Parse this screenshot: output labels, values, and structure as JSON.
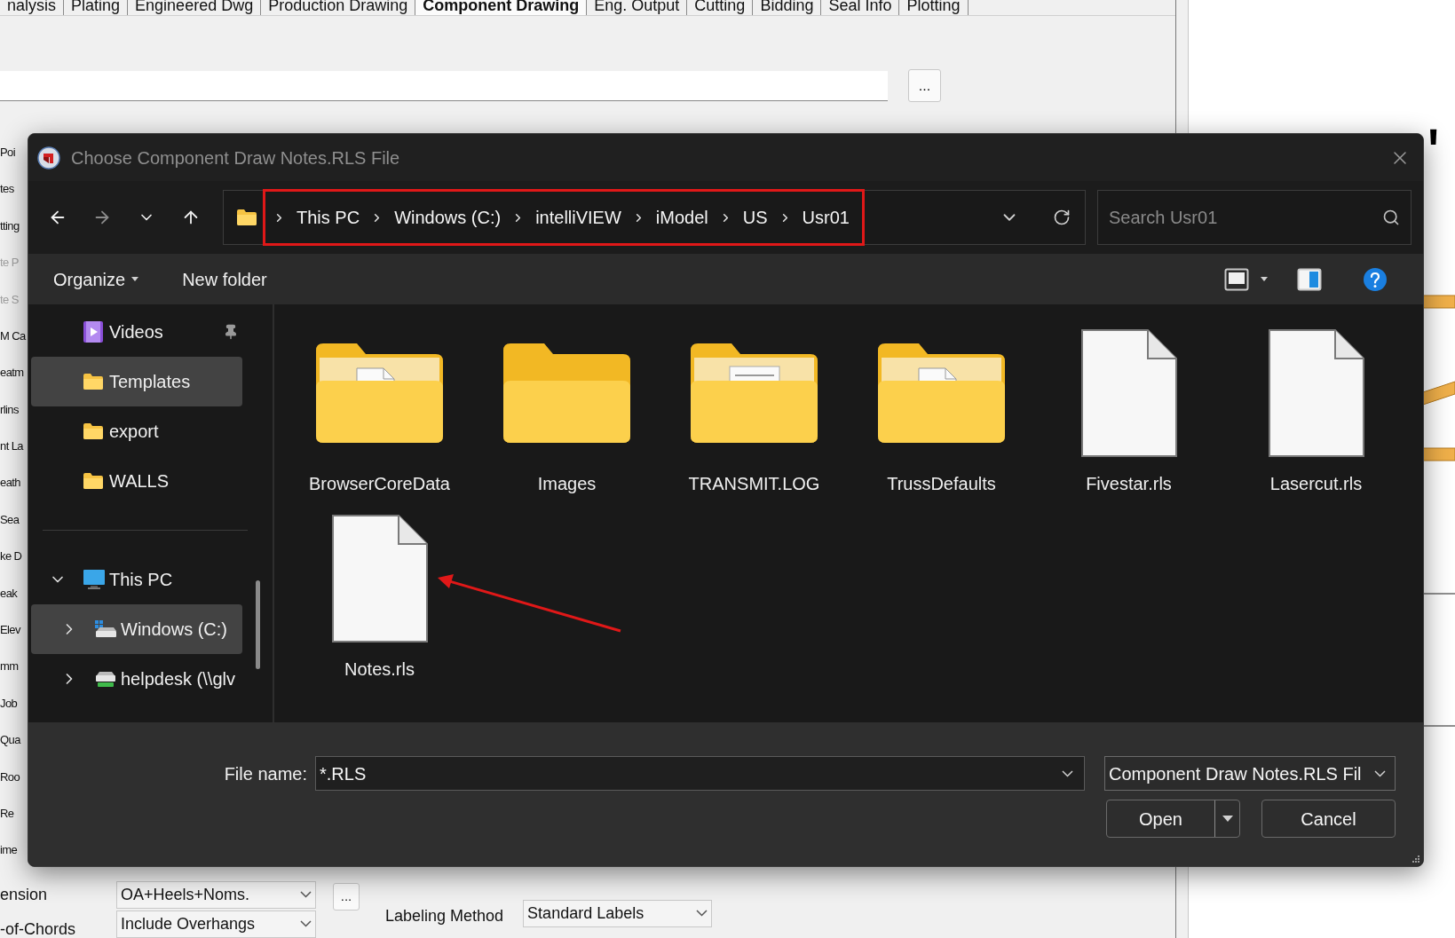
{
  "app": {
    "tabs": [
      {
        "label": "nalysis",
        "selected": false
      },
      {
        "label": "Plating",
        "selected": false
      },
      {
        "label": "Engineered Dwg",
        "selected": false
      },
      {
        "label": "Production Drawing",
        "selected": false
      },
      {
        "label": "Component Drawing",
        "selected": true
      },
      {
        "label": "Eng. Output",
        "selected": false
      },
      {
        "label": "Cutting",
        "selected": false
      },
      {
        "label": "Bidding",
        "selected": false
      },
      {
        "label": "Seal Info",
        "selected": false
      },
      {
        "label": "Plotting",
        "selected": false
      }
    ],
    "browse_button": "...",
    "side_labels": [
      {
        "text": "Poi",
        "disabled": false
      },
      {
        "text": "tes",
        "disabled": false
      },
      {
        "text": "tting",
        "disabled": false
      },
      {
        "text": "te P",
        "disabled": true
      },
      {
        "text": "te S",
        "disabled": true
      },
      {
        "text": "M Ca",
        "disabled": false
      },
      {
        "text": "eatm",
        "disabled": false
      },
      {
        "text": "rlins",
        "disabled": false
      },
      {
        "text": "nt La",
        "disabled": false
      },
      {
        "text": "eath",
        "disabled": false
      },
      {
        "text": "Sea",
        "disabled": false
      },
      {
        "text": "ke D",
        "disabled": false
      },
      {
        "text": "eak",
        "disabled": false
      },
      {
        "text": "Elev",
        "disabled": false
      },
      {
        "text": "mm",
        "disabled": false
      },
      {
        "text": "Job",
        "disabled": false
      },
      {
        "text": "Qua",
        "disabled": false
      },
      {
        "text": "Roo",
        "disabled": false
      },
      {
        "text": "Re",
        "disabled": false
      },
      {
        "text": "ime",
        "disabled": false
      }
    ],
    "dimension": {
      "label": "ension",
      "value": "OA+Heels+Noms.",
      "button": "..."
    },
    "labeling": {
      "label": "Labeling Method",
      "value": "Standard Labels"
    },
    "chords": {
      "label": "-of-Chords",
      "value": "Include Overhangs"
    },
    "drawing_text": "'"
  },
  "dialog": {
    "title": "Choose Component Draw Notes.RLS File",
    "breadcrumb": [
      "This PC",
      "Windows (C:)",
      "intelliVIEW",
      "iModel",
      "US",
      "Usr01"
    ],
    "search": {
      "placeholder": "Search Usr01"
    },
    "commands": [
      "Organize",
      "New folder"
    ],
    "quick_access": [
      {
        "label": "Videos",
        "kind": "video",
        "selected": false,
        "pinned": true
      },
      {
        "label": "Templates",
        "kind": "folder",
        "selected": true,
        "pinned": false
      },
      {
        "label": "export",
        "kind": "folder",
        "selected": false,
        "pinned": false
      },
      {
        "label": "WALLS",
        "kind": "folder",
        "selected": false,
        "pinned": false
      }
    ],
    "tree": [
      {
        "label": "This PC",
        "kind": "pc",
        "selected": false,
        "expanded": true,
        "children": [
          {
            "label": "Windows (C:)",
            "kind": "drive",
            "selected": true,
            "expanded": false
          },
          {
            "label": "helpdesk (\\\\glv",
            "kind": "netdrive",
            "selected": false,
            "expanded": false
          }
        ]
      }
    ],
    "files": [
      {
        "name": "BrowserCoreData",
        "kind": "folder_preview"
      },
      {
        "name": "Images",
        "kind": "folder"
      },
      {
        "name": "TRANSMIT.LOG",
        "kind": "folder_lines"
      },
      {
        "name": "TrussDefaults",
        "kind": "folder_preview"
      },
      {
        "name": "Fivestar.rls",
        "kind": "file"
      },
      {
        "name": "Lasercut.rls",
        "kind": "file"
      },
      {
        "name": "Notes.rls",
        "kind": "file"
      }
    ],
    "file_name": {
      "label": "File name:",
      "value": "*.RLS"
    },
    "filter": "Component Draw Notes.RLS Fil",
    "open": "Open",
    "cancel": "Cancel"
  }
}
